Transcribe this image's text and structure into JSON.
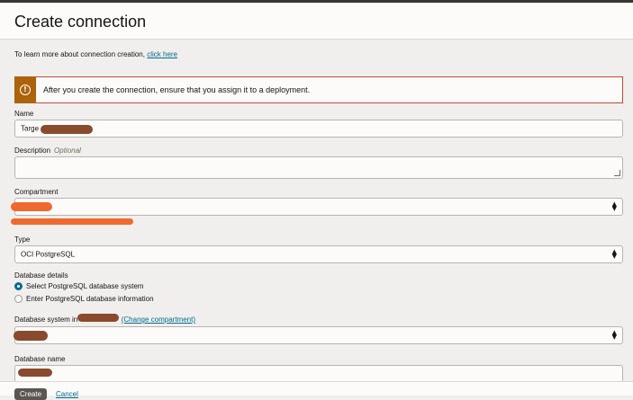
{
  "page": {
    "title": "Create connection"
  },
  "intro": {
    "text": "To learn more about connection creation,",
    "link": "click here"
  },
  "alert": {
    "message": "After you create the connection, ensure that you assign it to a deployment.",
    "icon": "warning-icon"
  },
  "fields": {
    "name": {
      "label": "Name",
      "value": "Targe"
    },
    "description": {
      "label": "Description",
      "optional": "Optional",
      "value": ""
    },
    "compartment": {
      "label": "Compartment",
      "value": ""
    },
    "type": {
      "label": "Type",
      "value": "OCI PostgreSQL"
    },
    "database_details": {
      "label": "Database details",
      "options": [
        "Select PostgreSQL database system",
        "Enter PostgreSQL database information"
      ],
      "selected_index": 0
    },
    "db_system": {
      "label": "Database system in",
      "change_link": "(Change compartment)",
      "value": ""
    },
    "db_name": {
      "label": "Database name",
      "value": ""
    }
  },
  "footer": {
    "create_label": "Create",
    "cancel_label": "Cancel"
  },
  "colors": {
    "accent": "#006b8f",
    "warning": "#ac630c",
    "alert_border": "#c74634"
  }
}
